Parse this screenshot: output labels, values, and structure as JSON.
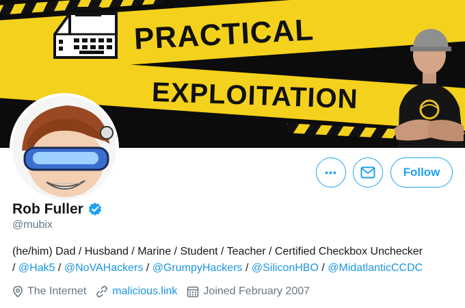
{
  "banner": {
    "line1": "PRACTICAL",
    "line2": "EXPLOITATION"
  },
  "actions": {
    "more_label": "•••",
    "follow_label": "Follow"
  },
  "profile": {
    "name": "Rob Fuller",
    "handle": "@mubix",
    "bio_text": "(he/him) Dad / Husband / Marine / Student / Teacher / Certified Checkbox Unchecker",
    "bio_links": [
      "@Hak5",
      "@NoVAHackers",
      "@GrumpyHackers",
      "@SiliconHBO",
      "@MidatlanticCCDC"
    ],
    "location": "The Internet",
    "website": "malicious.link",
    "joined": "Joined February 2007"
  },
  "colors": {
    "accent": "#1da1f2",
    "banner_yellow": "#f4d11c",
    "muted_text": "#657786"
  }
}
